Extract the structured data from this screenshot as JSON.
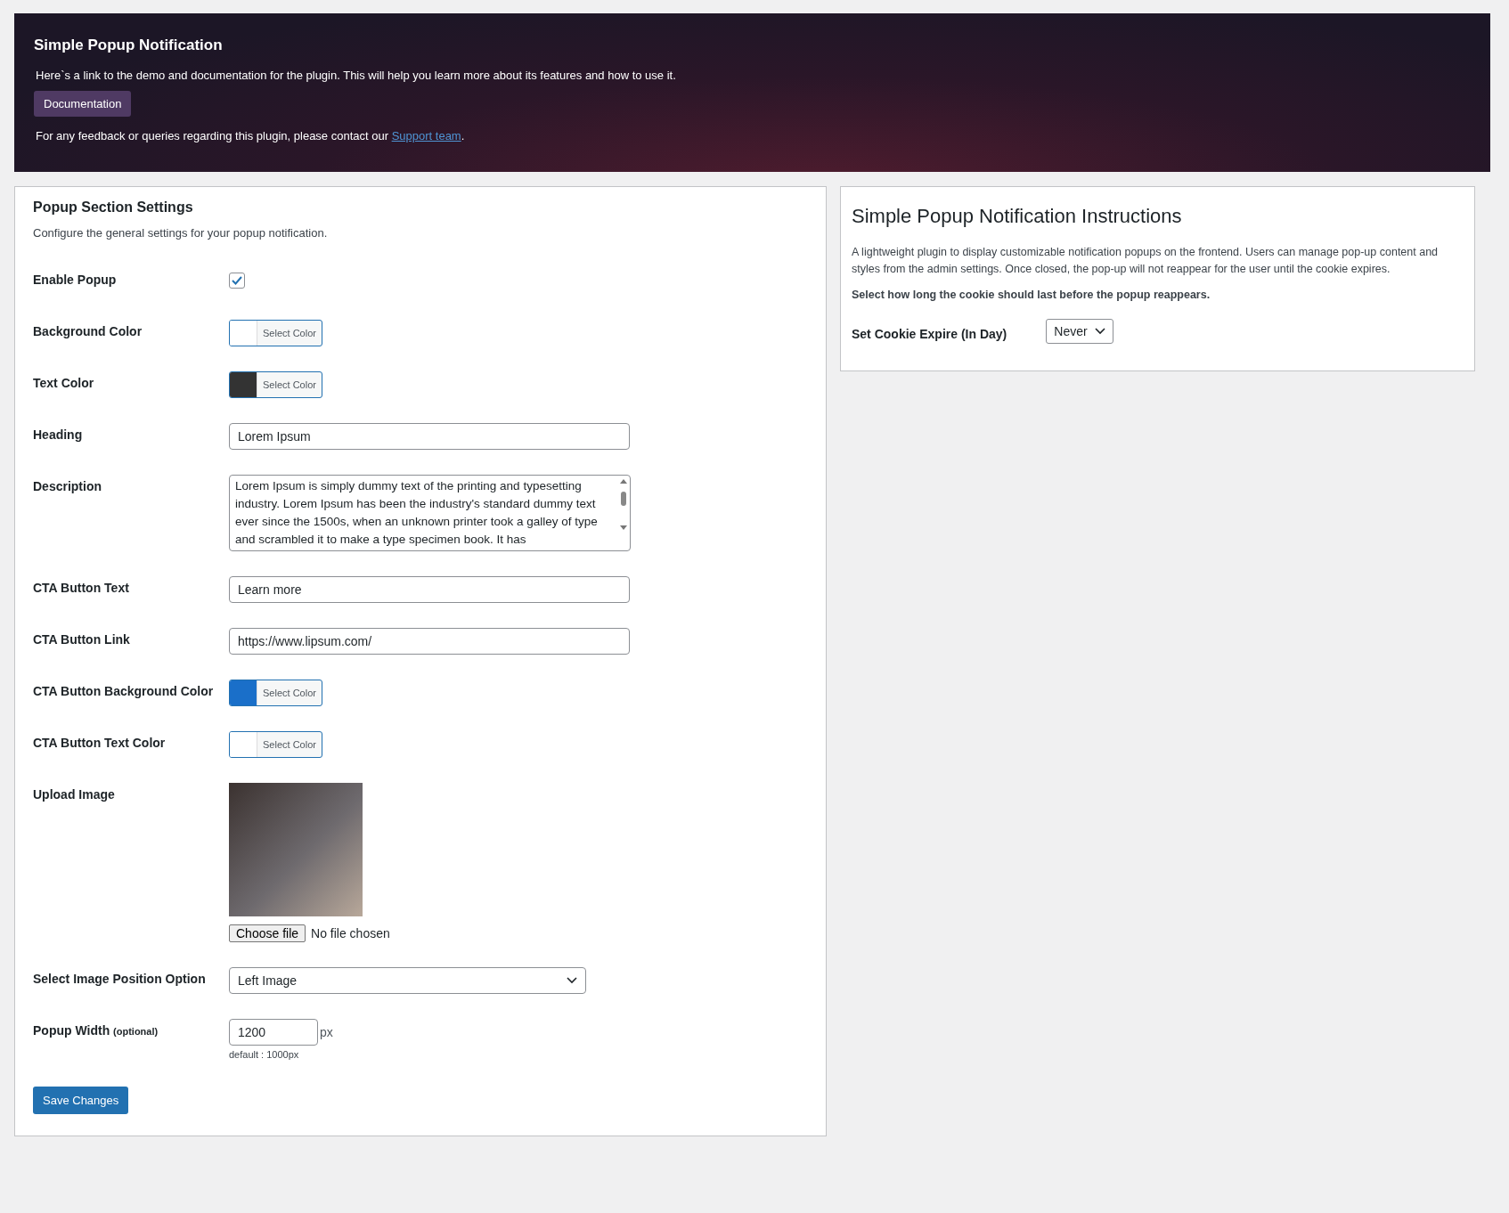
{
  "banner": {
    "title": "Simple Popup Notification",
    "intro": "Here`s a link to the demo and documentation for the plugin. This will help you learn more about its features and how to use it.",
    "button": "Documentation",
    "contact_text": "For any feedback or queries regarding this plugin, please contact our",
    "contact_link": "Support team",
    "contact_end": "."
  },
  "settings": {
    "title": "Popup Section Settings",
    "subtitle": "Configure the general settings for your popup notification.",
    "rows": [
      {
        "kind": "checkbox",
        "label": "Enable Popup",
        "checked": true
      },
      {
        "kind": "color",
        "label": "Background Color",
        "color": "#ffffff",
        "button": "Select Color"
      },
      {
        "kind": "color",
        "label": "Text Color",
        "color": "#333333",
        "button": "Select Color"
      },
      {
        "kind": "text",
        "label": "Heading",
        "value": "Lorem Ipsum"
      },
      {
        "kind": "textarea",
        "label": "Description",
        "value": "Lorem Ipsum is simply dummy text of the printing and typesetting industry. Lorem Ipsum has been the industry's standard dummy text ever since the 1500s, when an unknown printer took a galley of type and scrambled it to make a type specimen book. It has"
      },
      {
        "kind": "text",
        "label": "CTA Button Text",
        "value": "Learn more"
      },
      {
        "kind": "text",
        "label": "CTA Button Link",
        "value": "https://www.lipsum.com/"
      },
      {
        "kind": "color",
        "label": "CTA Button Background Color",
        "color": "#1a6fc9",
        "button": "Select Color"
      },
      {
        "kind": "color",
        "label": "CTA Button Text Color",
        "color": "#ffffff",
        "button": "Select Color"
      },
      {
        "kind": "image",
        "label": "Upload Image",
        "file_button": "Choose file",
        "file_status": "No file chosen"
      },
      {
        "kind": "select",
        "label": "Select Image Position Option",
        "value": "Left Image"
      },
      {
        "kind": "number",
        "label": "Popup Width",
        "label_note": "(optional)",
        "value": "1200",
        "unit": "px",
        "hint": "default : 1000px"
      }
    ],
    "save_button": "Save Changes"
  },
  "instructions": {
    "title": "Simple Popup Notification Instructions",
    "text": "A lightweight plugin to display customizable notification popups on the frontend. Users can manage pop-up content and styles from the admin settings. Once closed, the pop-up will not reappear for the user until the cookie expires.",
    "prompt": "Select how long the cookie should last before the popup reappears.",
    "field_label": "Set Cookie Expire (In Day)",
    "field_value": "Never"
  }
}
